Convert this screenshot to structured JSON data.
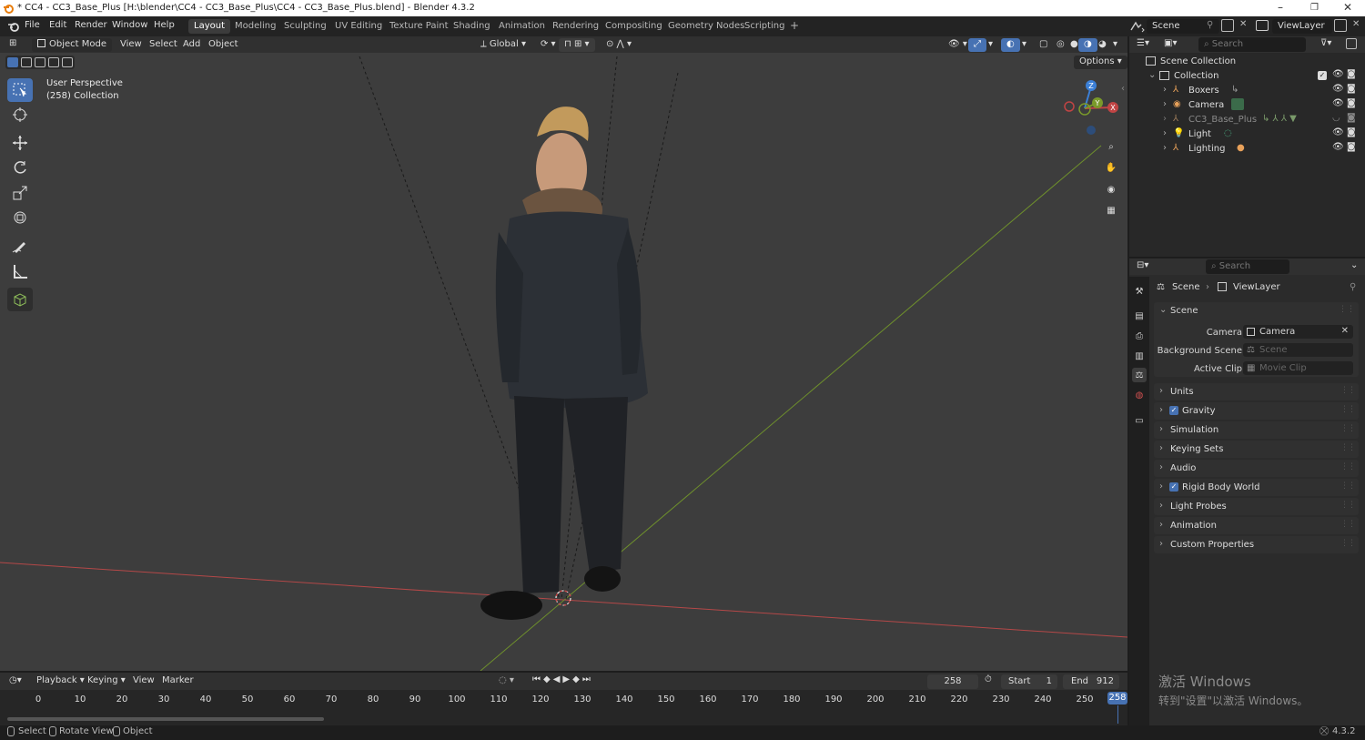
{
  "window": {
    "title": "* CC4 - CC3_Base_Plus [H:\\blender\\CC4 - CC3_Base_Plus\\CC4 - CC3_Base_Plus.blend] - Blender 4.3.2",
    "minimize": "–",
    "restore": "❐",
    "close": "✕"
  },
  "menubar": {
    "items": [
      "File",
      "Edit",
      "Render",
      "Window",
      "Help"
    ],
    "workspaces": [
      "Layout",
      "Modeling",
      "Sculpting",
      "UV Editing",
      "Texture Paint",
      "Shading",
      "Animation",
      "Rendering",
      "Compositing",
      "Geometry Nodes",
      "Scripting"
    ],
    "active_workspace": "Layout",
    "add_workspace": "+",
    "scene": "Scene",
    "view_layer": "ViewLayer"
  },
  "viewport": {
    "mode": "Object Mode",
    "menus": [
      "View",
      "Select",
      "Add",
      "Object"
    ],
    "orientation": "Global",
    "options": "Options",
    "info_line1": "User Perspective",
    "info_line2": "(258) Collection",
    "gizmo_x": "X",
    "gizmo_y": "Y",
    "gizmo_z": "Z",
    "tools": [
      "select-box",
      "cursor",
      "move",
      "rotate",
      "scale",
      "transform",
      "annotate",
      "measure",
      "add-cube"
    ]
  },
  "outliner": {
    "search_placeholder": "Search",
    "root": "Scene Collection",
    "collection": "Collection",
    "items": [
      {
        "name": "Boxers",
        "icon": "armature-icon",
        "dim": false
      },
      {
        "name": "Camera",
        "icon": "camera-icon",
        "dim": false
      },
      {
        "name": "CC3_Base_Plus",
        "icon": "armature-icon",
        "dim": true
      },
      {
        "name": "Light",
        "icon": "light-icon",
        "dim": false
      },
      {
        "name": "Lighting",
        "icon": "armature-icon",
        "dim": false
      }
    ]
  },
  "properties": {
    "search_placeholder": "Search",
    "breadcrumb_scene": "Scene",
    "breadcrumb_viewlayer": "ViewLayer",
    "section_scene": "Scene",
    "camera_label": "Camera",
    "camera_value": "Camera",
    "background_scene_label": "Background Scene",
    "background_scene_placeholder": "Scene",
    "active_clip_label": "Active Clip",
    "active_clip_placeholder": "Movie Clip",
    "panels": [
      {
        "label": "Units",
        "checkbox": false
      },
      {
        "label": "Gravity",
        "checkbox": true
      },
      {
        "label": "Simulation",
        "checkbox": false
      },
      {
        "label": "Keying Sets",
        "checkbox": false
      },
      {
        "label": "Audio",
        "checkbox": false
      },
      {
        "label": "Rigid Body World",
        "checkbox": true
      },
      {
        "label": "Light Probes",
        "checkbox": false
      },
      {
        "label": "Animation",
        "checkbox": false
      },
      {
        "label": "Custom Properties",
        "checkbox": false
      }
    ]
  },
  "timeline": {
    "menus": [
      "Playback",
      "Keying",
      "View",
      "Marker"
    ],
    "current_frame": "258",
    "start_label": "Start",
    "start_value": "1",
    "end_label": "End",
    "end_value": "912",
    "ticks": [
      "0",
      "10",
      "20",
      "30",
      "40",
      "50",
      "60",
      "70",
      "80",
      "90",
      "100",
      "110",
      "120",
      "130",
      "140",
      "150",
      "160",
      "170",
      "180",
      "190",
      "200",
      "210",
      "220",
      "230",
      "240",
      "250"
    ],
    "playhead_label": "258"
  },
  "watermark": {
    "line1": "激活 Windows",
    "line2": "转到\"设置\"以激活 Windows。"
  },
  "statusbar": {
    "select": "Select",
    "rotate_view": "Rotate View",
    "object": "Object",
    "version": "4.3.2"
  },
  "colors": {
    "accent": "#4772b3",
    "viewport_bg": "#3d3d3d",
    "x_axis": "#c04444",
    "y_axis": "#7a9a2a",
    "z_axis": "#3b7fd6"
  }
}
